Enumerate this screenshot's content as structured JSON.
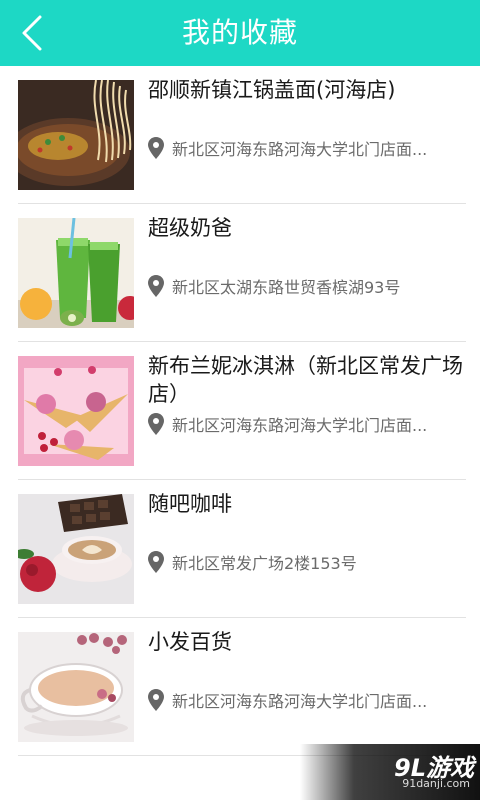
{
  "header": {
    "title": "我的收藏",
    "back_icon": "chevron-left-icon",
    "color": "#1dd8c5"
  },
  "favorites": [
    {
      "name": "邵顺新镇江锅盖面(河海店)",
      "address": "新北区河海东路河海大学北门店面...",
      "image": "noodle-bowl"
    },
    {
      "name": "超级奶爸",
      "address": "新北区太湖东路世贸香槟湖93号",
      "image": "green-juice"
    },
    {
      "name": "新布兰妮冰淇淋（新北区常发广场店）",
      "address": "新北区河海东路河海大学北门店面...",
      "image": "ice-cream-cones"
    },
    {
      "name": "随吧咖啡",
      "address": "新北区常发广场2楼153号",
      "image": "latte-cup"
    },
    {
      "name": "小发百货",
      "address": "新北区河海东路河海大学北门店面...",
      "image": "milk-tea-cup"
    }
  ],
  "location_icon": "map-pin-icon",
  "watermark": {
    "logo": "9L游戏",
    "site": "91danji.com"
  }
}
